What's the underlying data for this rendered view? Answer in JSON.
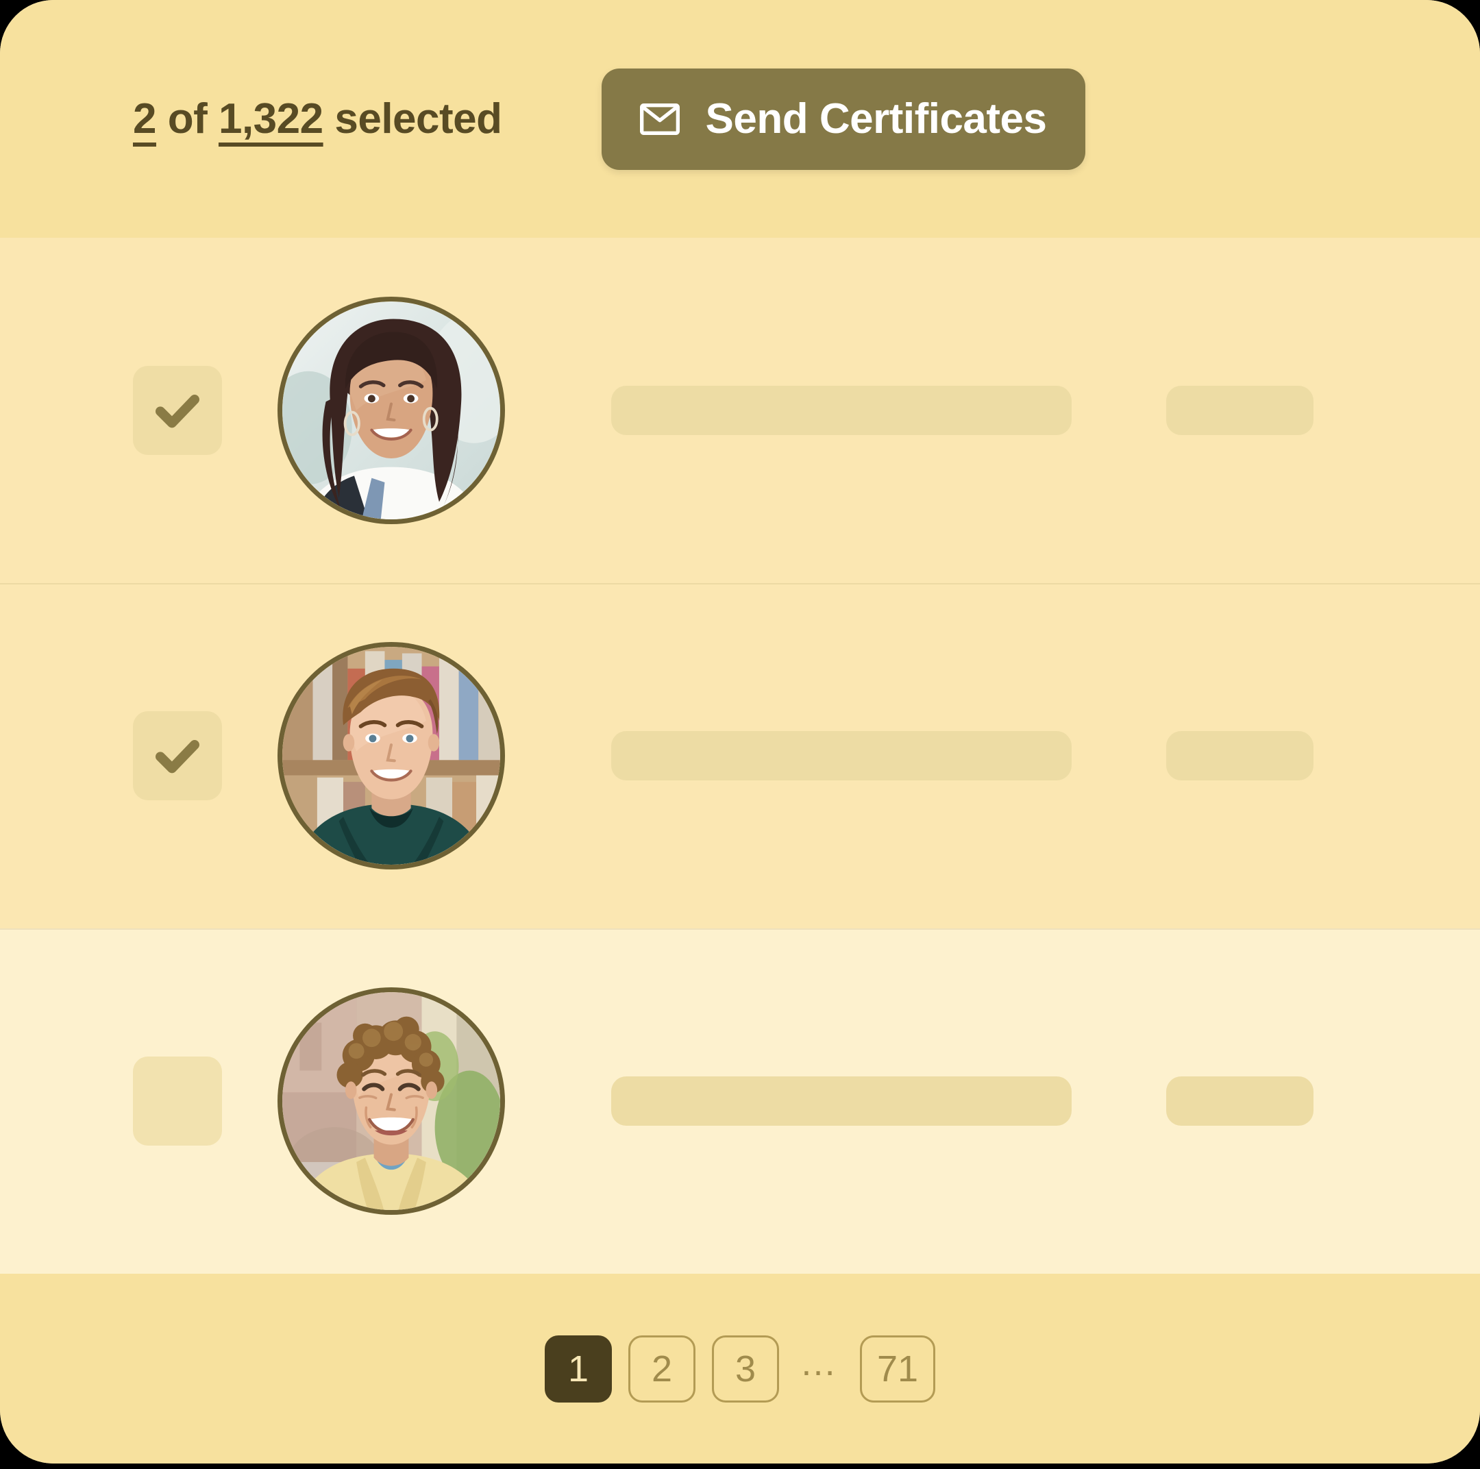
{
  "card": {
    "background_color": "#FCEBBE",
    "accent_color": "#857947",
    "text_color": "#584B24"
  },
  "bulk_bar": {
    "selection_summary": {
      "selected_count": "2",
      "connector": " of ",
      "total_count": "1,322",
      "suffix": " selected",
      "full_text": "2 of 1,322 selected"
    },
    "send_button": {
      "label": "Send Certificates",
      "icon": "envelope-icon",
      "background_color": "#857947",
      "text_color": "#FFFFFF"
    }
  },
  "rows": [
    {
      "checked": true,
      "check_icon": "check-icon",
      "avatar": "avatar-woman-curly-hair",
      "skeleton_name_width": "672",
      "skeleton_meta_width": "215"
    },
    {
      "checked": true,
      "check_icon": "check-icon",
      "avatar": "avatar-young-man-hoodie",
      "skeleton_name_width": "672",
      "skeleton_meta_width": "215"
    },
    {
      "checked": false,
      "check_icon": "",
      "avatar": "avatar-man-curly-hair",
      "skeleton_name_width": "672",
      "skeleton_meta_width": "215"
    }
  ],
  "pagination": {
    "pages": [
      {
        "label": "1",
        "active": true
      },
      {
        "label": "2",
        "active": false
      },
      {
        "label": "3",
        "active": false
      }
    ],
    "ellipsis": "…",
    "last_page": {
      "label": "71",
      "active": false
    },
    "active_color": "#4A3F1E",
    "inactive_color": "#A08B4C"
  }
}
